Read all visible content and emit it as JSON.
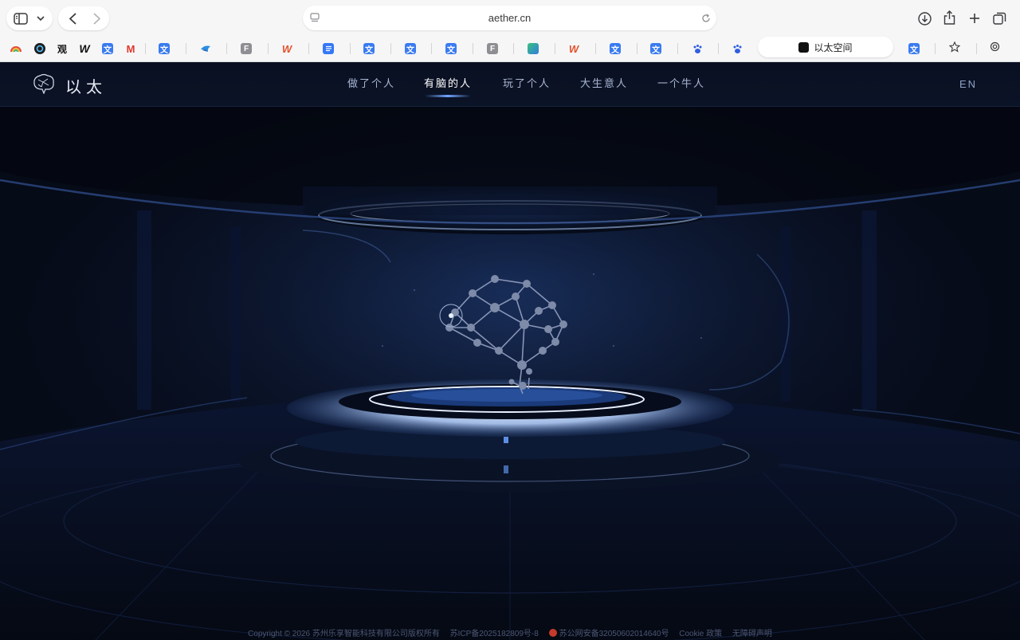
{
  "browser": {
    "address": "aether.cn",
    "active_tab_title": "以太空间",
    "bookmarks": [
      {
        "name": "rainbow"
      },
      {
        "name": "circle"
      },
      {
        "name": "观"
      },
      {
        "name": "W"
      },
      {
        "name": "doc"
      },
      {
        "name": "gmail"
      },
      {
        "name": "doc"
      },
      {
        "name": "bird"
      },
      {
        "name": "F"
      },
      {
        "name": "wps"
      },
      {
        "name": "lines"
      },
      {
        "name": "doc"
      },
      {
        "name": "doc"
      },
      {
        "name": "doc"
      },
      {
        "name": "F"
      },
      {
        "name": "cube"
      },
      {
        "name": "wps"
      },
      {
        "name": "doc"
      },
      {
        "name": "doc"
      },
      {
        "name": "paw"
      },
      {
        "name": "paw"
      }
    ],
    "bookmark_labels": {
      "guan": "观",
      "w": "W",
      "f": "F",
      "m": "M"
    }
  },
  "site": {
    "logo_text": "以太",
    "nav": [
      "做了个人",
      "有脑的人",
      "玩了个人",
      "大生意人",
      "一个牛人"
    ],
    "active_nav_index": 1,
    "lang": "EN",
    "accent_color": "#6fa4ff"
  },
  "footer": {
    "copyright": "Copyright © 2026 苏州乐享智能科技有限公司版权所有",
    "icp": "苏ICP备2025182809号-8",
    "police": "苏公网安备32050602014640号",
    "cookie": "Cookie 政策",
    "accessibility": "无障碍声明"
  }
}
